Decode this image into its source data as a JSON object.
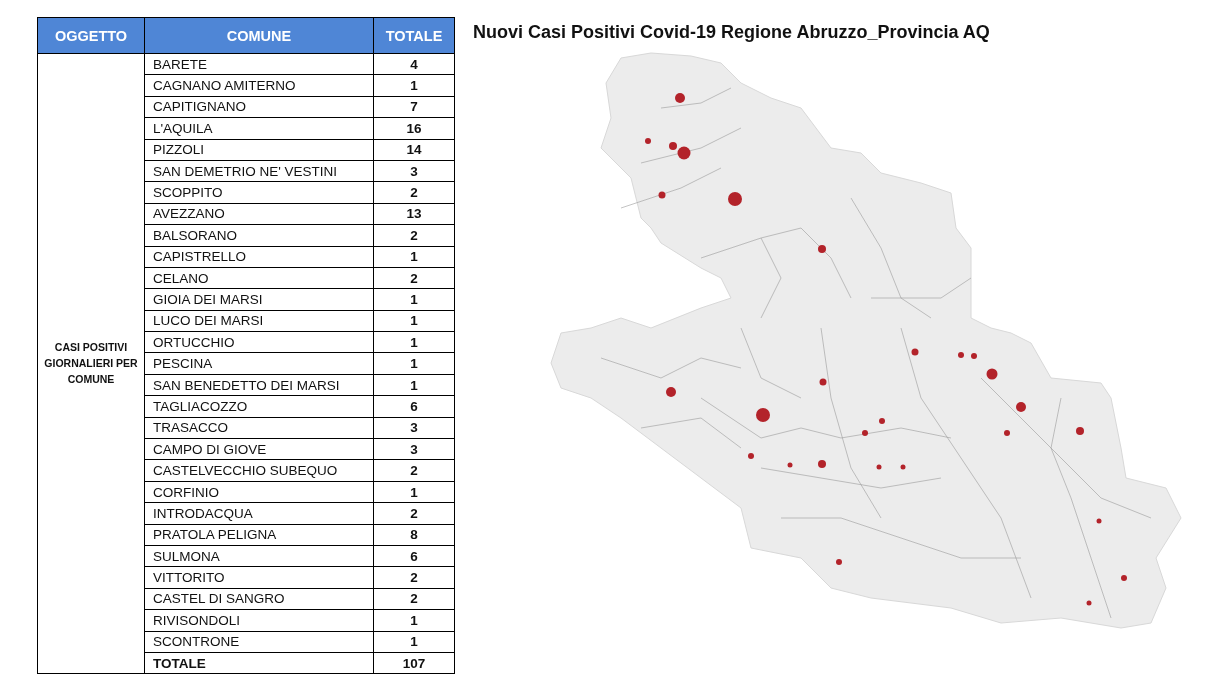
{
  "table": {
    "columns": [
      "OGGETTO",
      "COMUNE",
      "TOTALE"
    ],
    "oggetto": "CASI POSITIVI GIORNALIERI PER COMUNE",
    "rows": [
      {
        "comune": "BARETE",
        "totale": "4"
      },
      {
        "comune": "CAGNANO AMITERNO",
        "totale": "1"
      },
      {
        "comune": "CAPITIGNANO",
        "totale": "7"
      },
      {
        "comune": "L'AQUILA",
        "totale": "16"
      },
      {
        "comune": "PIZZOLI",
        "totale": "14"
      },
      {
        "comune": "SAN DEMETRIO NE' VESTINI",
        "totale": "3"
      },
      {
        "comune": "SCOPPITO",
        "totale": "2"
      },
      {
        "comune": "AVEZZANO",
        "totale": "13"
      },
      {
        "comune": "BALSORANO",
        "totale": "2"
      },
      {
        "comune": "CAPISTRELLO",
        "totale": "1"
      },
      {
        "comune": "CELANO",
        "totale": "2"
      },
      {
        "comune": "GIOIA DEI MARSI",
        "totale": "1"
      },
      {
        "comune": "LUCO DEI MARSI",
        "totale": "1"
      },
      {
        "comune": "ORTUCCHIO",
        "totale": "1"
      },
      {
        "comune": "PESCINA",
        "totale": "1"
      },
      {
        "comune": "SAN BENEDETTO DEI MARSI",
        "totale": "1"
      },
      {
        "comune": "TAGLIACOZZO",
        "totale": "6"
      },
      {
        "comune": "TRASACCO",
        "totale": "3"
      },
      {
        "comune": "CAMPO DI GIOVE",
        "totale": "3"
      },
      {
        "comune": "CASTELVECCHIO SUBEQUO",
        "totale": "2"
      },
      {
        "comune": "CORFINIO",
        "totale": "1"
      },
      {
        "comune": "INTRODACQUA",
        "totale": "2"
      },
      {
        "comune": "PRATOLA PELIGNA",
        "totale": "8"
      },
      {
        "comune": "SULMONA",
        "totale": "6"
      },
      {
        "comune": "VITTORITO",
        "totale": "2"
      },
      {
        "comune": "CASTEL DI SANGRO",
        "totale": "2"
      },
      {
        "comune": "RIVISONDOLI",
        "totale": "1"
      },
      {
        "comune": "SCONTRONE",
        "totale": "1"
      }
    ],
    "total": {
      "label": "TOTALE",
      "value": "107"
    }
  },
  "map": {
    "title": "Nuovi Casi Positivi Covid-19 Regione Abruzzo_Provincia AQ"
  }
}
